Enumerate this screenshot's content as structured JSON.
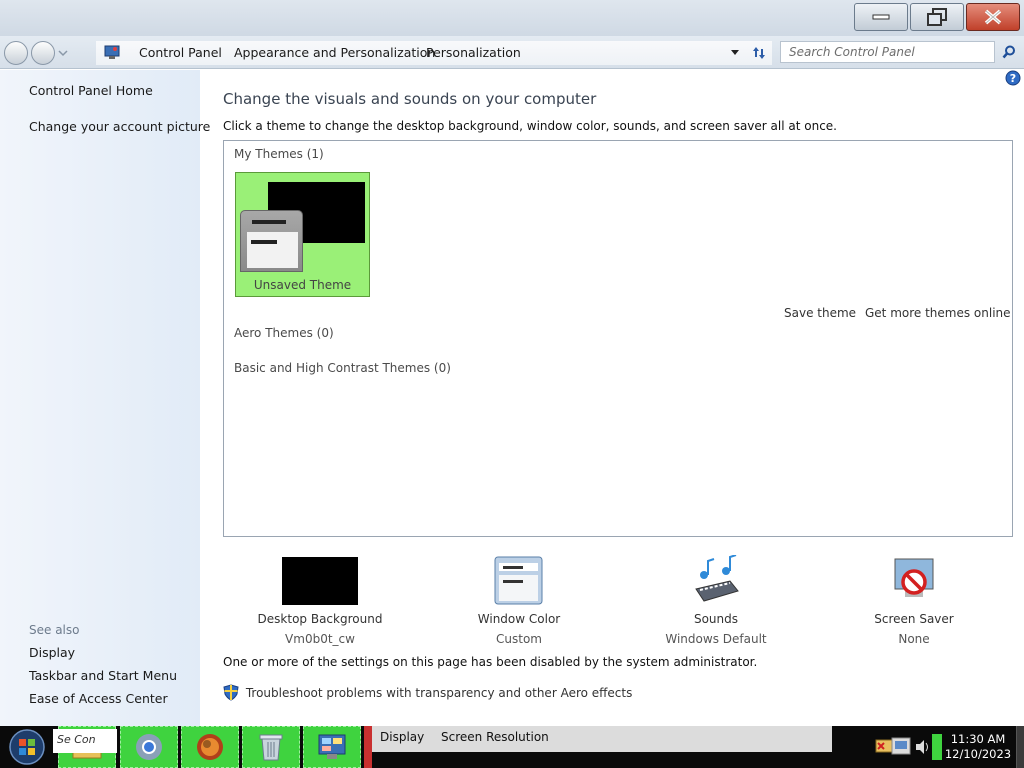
{
  "address": {
    "crumbs": [
      "Control Panel",
      "Appearance and Personalization",
      "Personalization"
    ],
    "search_placeholder": "Search Control Panel"
  },
  "leftnav": {
    "items": [
      "Control Panel Home",
      "Change your account picture"
    ],
    "see_also_label": "See also",
    "see_also": [
      "Display",
      "Taskbar and Start Menu",
      "Ease of Access Center"
    ]
  },
  "main": {
    "heading": "Change the visuals and sounds on your computer",
    "subtitle": "Click a theme to change the desktop background, window color, sounds, and screen saver all at once.",
    "groups": {
      "my_themes": "My Themes (1)",
      "aero_themes": "Aero Themes (0)",
      "basic_themes": "Basic and High Contrast Themes (0)"
    },
    "selected_theme": "Unsaved Theme",
    "save_theme": "Save theme",
    "more_themes": "Get more themes online",
    "settings": [
      {
        "label": "Desktop Background",
        "value": "Vm0b0t_cw"
      },
      {
        "label": "Window Color",
        "value": "Custom"
      },
      {
        "label": "Sounds",
        "value": "Windows Default"
      },
      {
        "label": "Screen Saver",
        "value": "None"
      }
    ],
    "disabled_note": "One or more of the settings on this page has been disabled by the system administrator.",
    "troubleshoot": "Troubleshoot problems with transparency and other Aero effects"
  },
  "taskbar": {
    "search_fragment": "Se   Con",
    "strip_items": [
      "Display",
      "Screen Resolution"
    ],
    "time": "11:30 AM",
    "date": "12/10/2023",
    "app_icons": [
      "explorer-icon",
      "chrome-icon",
      "firefox-icon",
      "recycle-bin-icon",
      "control-panel-icon"
    ],
    "colors": {
      "highlight": "#3fd33f",
      "theme_tile": "#9af077"
    }
  }
}
